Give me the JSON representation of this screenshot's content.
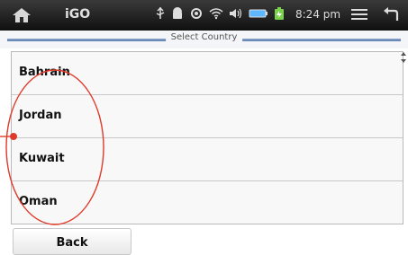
{
  "status_bar": {
    "app_title": "iGO",
    "time": "8:24 pm",
    "home_icon": "home-icon",
    "menu_icon": "menu-icon",
    "back_icon": "return-arrow-icon",
    "indicator_icons": [
      "usb-icon",
      "android-icon",
      "gps-icon",
      "wifi-icon",
      "volume-icon",
      "battery-icon",
      "charging-icon"
    ]
  },
  "header": {
    "title": "Select Country"
  },
  "country_list": {
    "items": [
      {
        "label": "Bahrain"
      },
      {
        "label": "Jordan"
      },
      {
        "label": "Kuwait"
      },
      {
        "label": "Oman"
      }
    ]
  },
  "footer": {
    "back_label": "Back"
  },
  "colors": {
    "status_bar_bg": "#1a1a1a",
    "header_line": "#6a8ab8",
    "annotation": "#e03a2a"
  }
}
